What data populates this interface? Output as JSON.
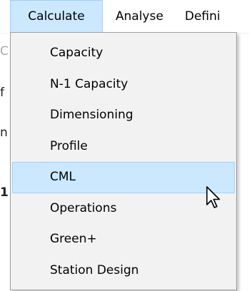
{
  "menubar": {
    "items": [
      {
        "label": "Calculate"
      },
      {
        "label": "Analyse"
      },
      {
        "label": "Defini"
      }
    ]
  },
  "background": {
    "fragments": [
      "C",
      "f",
      "n",
      "1"
    ]
  },
  "calculate_menu": {
    "items": [
      {
        "label": "Capacity"
      },
      {
        "label": "N-1 Capacity"
      },
      {
        "label": "Dimensioning"
      },
      {
        "label": "Profile"
      },
      {
        "label": "CML"
      },
      {
        "label": "Operations"
      },
      {
        "label": "Green+"
      },
      {
        "label": "Station Design"
      }
    ],
    "highlighted_item": "CML"
  },
  "colors": {
    "highlight_fill": "#cce8ff",
    "highlight_border": "#99d1ff",
    "menu_background": "#f2f2f2"
  }
}
